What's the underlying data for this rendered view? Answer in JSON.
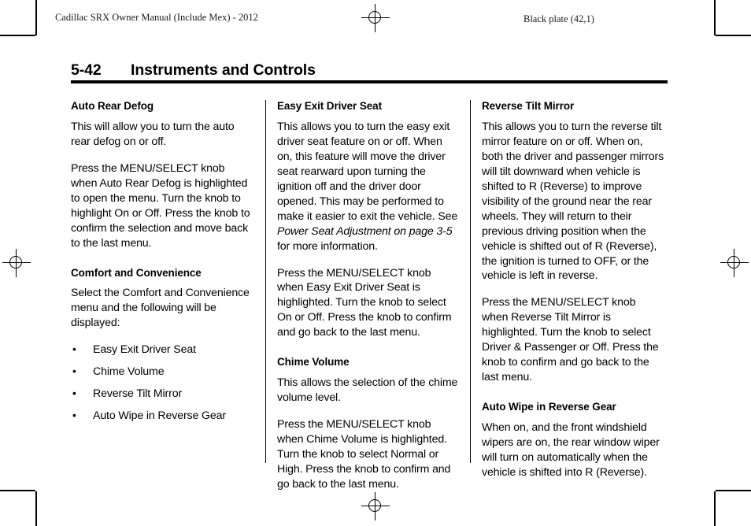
{
  "running_head": {
    "left": "Cadillac SRX Owner Manual (Include Mex) - 2012",
    "right": "Black plate (42,1)"
  },
  "page_title": {
    "number": "5-42",
    "text": "Instruments and Controls"
  },
  "columns": [
    {
      "id": "column-1",
      "blocks": [
        {
          "type": "heading",
          "text": "Auto Rear Defog"
        },
        {
          "type": "paragraph",
          "text": "This will allow you to turn the auto rear defog on or off."
        },
        {
          "type": "paragraph",
          "text": "Press the MENU/SELECT knob when Auto Rear Defog is highlighted to open the menu. Turn the knob to highlight On or Off. Press the knob to confirm the selection and move back to the last menu."
        },
        {
          "type": "heading",
          "text": "Comfort and Convenience"
        },
        {
          "type": "paragraph",
          "text": "Select the Comfort and Convenience menu and the following will be displayed:"
        },
        {
          "type": "list",
          "bullet_glyph": "•",
          "items": [
            "Easy Exit Driver Seat",
            "Chime Volume",
            "Reverse Tilt Mirror",
            "Auto Wipe in Reverse Gear"
          ]
        }
      ]
    },
    {
      "id": "column-2",
      "blocks": [
        {
          "type": "heading",
          "text": "Easy Exit Driver Seat"
        },
        {
          "type": "paragraph_xref",
          "text_before": "This allows you to turn the easy exit driver seat feature on or off. When on, this feature will move the driver seat rearward upon turning the ignition off and the driver door opened. This may be performed to make it easier to exit the vehicle. See ",
          "xref": "Power Seat Adjustment on page 3-5",
          "text_after": " for more information."
        },
        {
          "type": "paragraph",
          "text": "Press the MENU/SELECT knob when Easy Exit Driver Seat is highlighted. Turn the knob to select On or Off. Press the knob to confirm and go back to the last menu."
        },
        {
          "type": "heading",
          "text": "Chime Volume"
        },
        {
          "type": "paragraph",
          "text": "This allows the selection of the chime volume level."
        },
        {
          "type": "paragraph",
          "text": "Press the MENU/SELECT knob when Chime Volume is highlighted. Turn the knob to select Normal or High. Press the knob to confirm and go back to the last menu."
        }
      ]
    },
    {
      "id": "column-3",
      "blocks": [
        {
          "type": "heading",
          "text": "Reverse Tilt Mirror"
        },
        {
          "type": "paragraph",
          "text": "This allows you to turn the reverse tilt mirror feature on or off. When on, both the driver and passenger mirrors will tilt downward when vehicle is shifted to R (Reverse) to improve visibility of the ground near the rear wheels. They will return to their previous driving position when the vehicle is shifted out of R (Reverse), the ignition is turned to OFF, or the vehicle is left in reverse."
        },
        {
          "type": "paragraph",
          "text": "Press the MENU/SELECT knob when Reverse Tilt Mirror is highlighted. Turn the knob to select Driver & Passenger or Off. Press the knob to confirm and go back to the last menu."
        },
        {
          "type": "heading",
          "text": "Auto Wipe in Reverse Gear"
        },
        {
          "type": "paragraph",
          "text": "When on, and the front windshield wipers are on, the rear window wiper will turn on automatically when the vehicle is shifted into R (Reverse)."
        }
      ]
    }
  ],
  "print_marks": {
    "registration_icon": "registration-target-icon",
    "crop_icon": "crop-mark"
  }
}
